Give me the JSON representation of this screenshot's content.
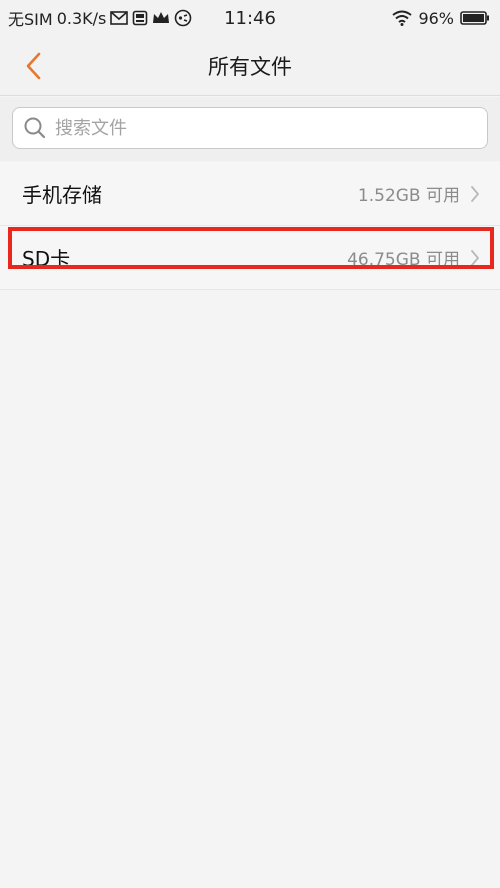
{
  "status_bar": {
    "carrier": "无SIM",
    "net_speed": "0.3K/s",
    "time": "11:46",
    "battery": "96%",
    "icons": [
      "mail-icon",
      "app-notification-icon",
      "crown-icon",
      "game-icon",
      "wifi-icon",
      "battery-icon"
    ]
  },
  "header": {
    "title": "所有文件",
    "back_icon": "chevron-left-icon"
  },
  "search": {
    "placeholder": "搜索文件",
    "value": ""
  },
  "storage_list": [
    {
      "label": "手机存储",
      "available": "1.52GB 可用"
    },
    {
      "label": "SD卡",
      "available": "46.75GB 可用"
    }
  ],
  "colors": {
    "accent": "#e8772e",
    "highlight": "#e8281f",
    "background": "#f4f4f4"
  }
}
